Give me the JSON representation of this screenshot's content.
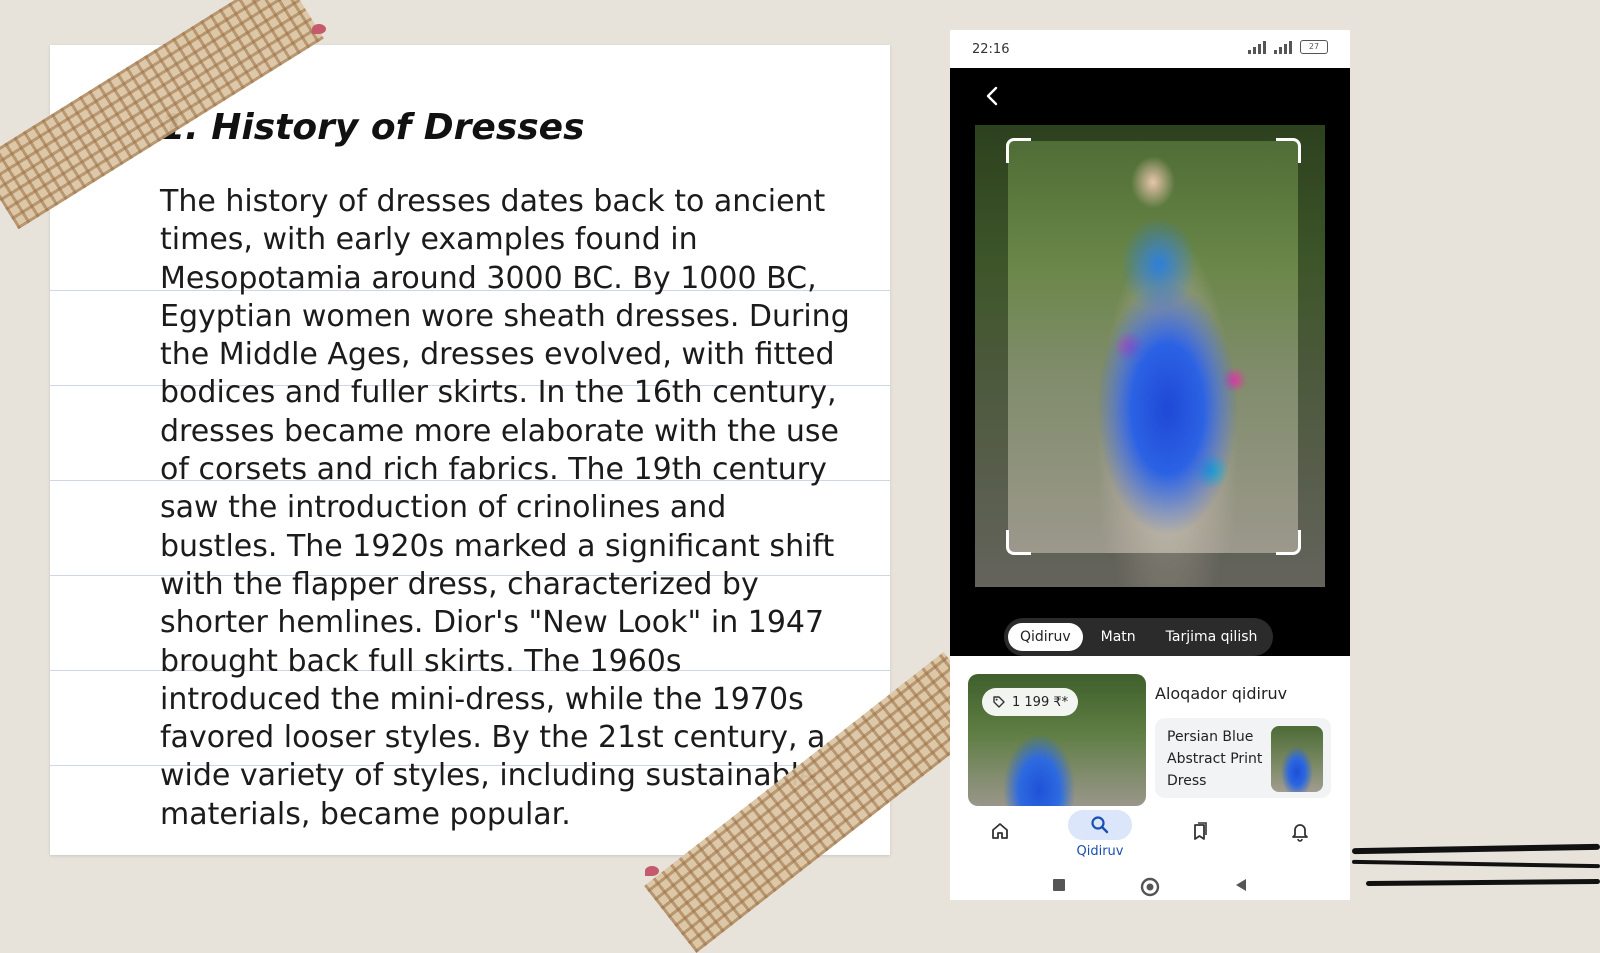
{
  "slide": {
    "title": "1. History of Dresses",
    "body": "The history of dresses dates back to ancient times, with early examples found in Mesopotamia around 3000 BC. By 1000 BC, Egyptian women wore sheath dresses. During the Middle Ages, dresses evolved, with fitted bodices and fuller skirts. In the 16th century, dresses became more elaborate with the use of corsets and rich fabrics. The 19th century saw the introduction of crinolines and bustles. The 1920s marked a significant shift with the flapper dress, characterized by shorter hemlines. Dior's \"New Look\" in 1947 brought back full skirts. The 1960s introduced the mini-dress, while the 1970s favored looser styles. By the 21st century, a wide variety of styles, including sustainable materials, became popular."
  },
  "phone": {
    "status": {
      "time": "22:16",
      "battery": "27"
    },
    "modes": [
      "Qidiruv",
      "Matn",
      "Tarjima qilish"
    ],
    "active_mode": "Qidiruv",
    "result": {
      "price": "1 199 ₹*"
    },
    "related": {
      "title": "Aloqador qidiruv",
      "item": "Persian Blue Abstract Print Dress"
    },
    "nav": {
      "search_label": "Qidiruv"
    }
  }
}
